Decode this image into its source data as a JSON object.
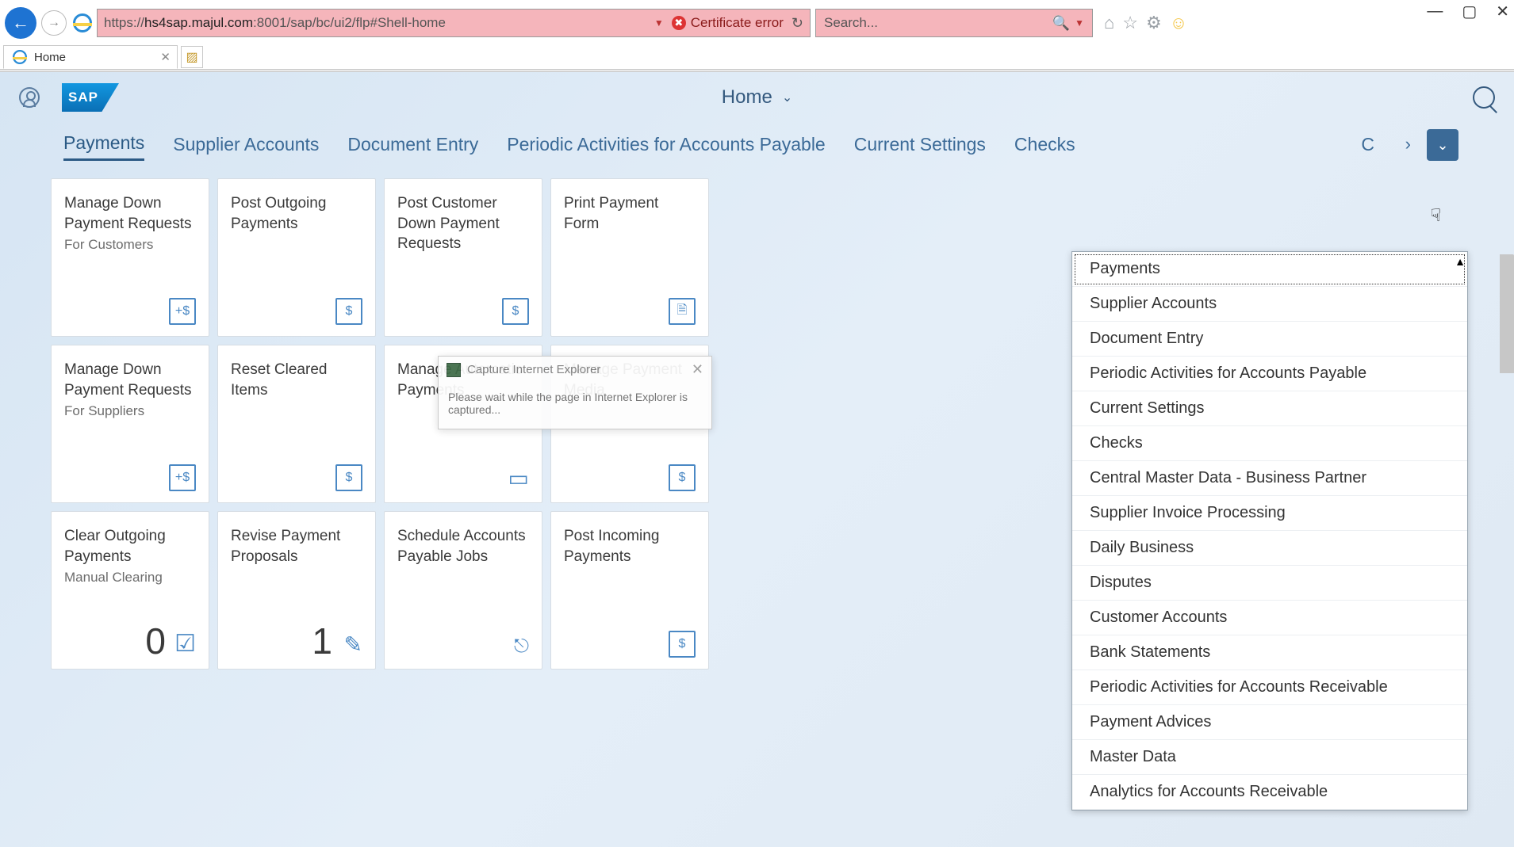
{
  "browser": {
    "url_prefix": "https://",
    "url_host": "hs4sap.majul.com",
    "url_port_path": ":8001/sap/bc/ui2/flp#Shell-home",
    "cert_error": "Certificate error",
    "search_placeholder": "Search...",
    "tab_title": "Home"
  },
  "shell": {
    "title": "Home",
    "logo_text": "SAP"
  },
  "anchors": [
    "Payments",
    "Supplier Accounts",
    "Document Entry",
    "Periodic Activities for Accounts Payable",
    "Current Settings",
    "Checks"
  ],
  "anchors_clipped": "C",
  "tiles": [
    [
      {
        "title": "Manage Down Payment Requests",
        "sub": "For Customers"
      },
      {
        "title": "Post Outgoing Payments"
      },
      {
        "title": "Post Customer Down Payment Requests"
      },
      {
        "title": "Print Payment Form"
      }
    ],
    [
      {
        "title": "Manage Down Payment Requests",
        "sub": "For Suppliers"
      },
      {
        "title": "Reset Cleared Items"
      },
      {
        "title": "Manage Automatic Payments"
      },
      {
        "title": "Manage Payment Media"
      }
    ],
    [
      {
        "title": "Clear Outgoing Payments",
        "sub": "Manual Clearing",
        "kpi": "0"
      },
      {
        "title": "Revise Payment Proposals",
        "kpi": "1"
      },
      {
        "title": "Schedule Accounts Payable Jobs"
      },
      {
        "title": "Post Incoming Payments"
      }
    ]
  ],
  "dropdown": [
    "Payments",
    "Supplier Accounts",
    "Document Entry",
    "Periodic Activities for Accounts Payable",
    "Current Settings",
    "Checks",
    "Central Master Data - Business Partner",
    "Supplier Invoice Processing",
    "Daily Business",
    "Disputes",
    "Customer Accounts",
    "Bank Statements",
    "Periodic Activities for Accounts Receivable",
    "Payment Advices",
    "Master Data",
    "Analytics for Accounts Receivable"
  ],
  "capture": {
    "title": "Capture Internet Explorer",
    "body": "Please wait while the page in Internet Explorer is captured..."
  }
}
